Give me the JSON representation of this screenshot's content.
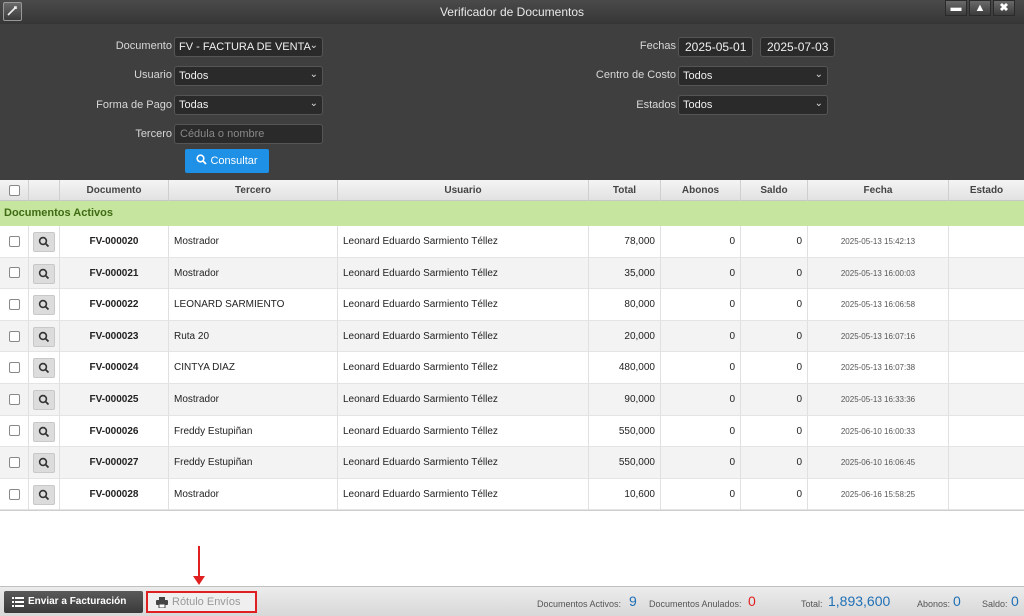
{
  "window": {
    "title": "Verificador de Documentos",
    "buttons": {
      "minimize": "▬",
      "maximize": "▲",
      "close": "✖"
    }
  },
  "filters": {
    "documento_label": "Documento",
    "documento_value": "FV - FACTURA DE VENTA",
    "usuario_label": "Usuario",
    "usuario_value": "Todos",
    "forma_pago_label": "Forma de Pago",
    "forma_pago_value": "Todas",
    "tercero_label": "Tercero",
    "tercero_placeholder": "Cédula o nombre",
    "fechas_label": "Fechas",
    "fecha_desde": "2025-05-01",
    "fecha_hasta": "2025-07-03",
    "centro_costo_label": "Centro de Costo",
    "centro_costo_value": "Todos",
    "estados_label": "Estados",
    "estados_value": "Todos",
    "consultar_label": "Consultar"
  },
  "table": {
    "headers": [
      "Documento",
      "Tercero",
      "Usuario",
      "Total",
      "Abonos",
      "Saldo",
      "Fecha",
      "Estado"
    ],
    "group_label": "Documentos Activos",
    "rows": [
      {
        "documento": "FV-000020",
        "tercero": "Mostrador",
        "usuario": "Leonard Eduardo Sarmiento Téllez",
        "total": "78,000",
        "abonos": "0",
        "saldo": "0",
        "fecha": "2025-05-13 15:42:13"
      },
      {
        "documento": "FV-000021",
        "tercero": "Mostrador",
        "usuario": "Leonard Eduardo Sarmiento Téllez",
        "total": "35,000",
        "abonos": "0",
        "saldo": "0",
        "fecha": "2025-05-13 16:00:03"
      },
      {
        "documento": "FV-000022",
        "tercero": "LEONARD SARMIENTO",
        "usuario": "Leonard Eduardo Sarmiento Téllez",
        "total": "80,000",
        "abonos": "0",
        "saldo": "0",
        "fecha": "2025-05-13 16:06:58"
      },
      {
        "documento": "FV-000023",
        "tercero": "Ruta 20",
        "usuario": "Leonard Eduardo Sarmiento Téllez",
        "total": "20,000",
        "abonos": "0",
        "saldo": "0",
        "fecha": "2025-05-13 16:07:16"
      },
      {
        "documento": "FV-000024",
        "tercero": "CINTYA DIAZ",
        "usuario": "Leonard Eduardo Sarmiento Téllez",
        "total": "480,000",
        "abonos": "0",
        "saldo": "0",
        "fecha": "2025-05-13 16:07:38"
      },
      {
        "documento": "FV-000025",
        "tercero": "Mostrador",
        "usuario": "Leonard Eduardo Sarmiento Téllez",
        "total": "90,000",
        "abonos": "0",
        "saldo": "0",
        "fecha": "2025-05-13 16:33:36"
      },
      {
        "documento": "FV-000026",
        "tercero": "Freddy Estupiñan",
        "usuario": "Leonard Eduardo Sarmiento Téllez",
        "total": "550,000",
        "abonos": "0",
        "saldo": "0",
        "fecha": "2025-06-10 16:00:33"
      },
      {
        "documento": "FV-000027",
        "tercero": "Freddy Estupiñan",
        "usuario": "Leonard Eduardo Sarmiento Téllez",
        "total": "550,000",
        "abonos": "0",
        "saldo": "0",
        "fecha": "2025-06-10 16:06:45"
      },
      {
        "documento": "FV-000028",
        "tercero": "Mostrador",
        "usuario": "Leonard Eduardo Sarmiento Téllez",
        "total": "10,600",
        "abonos": "0",
        "saldo": "0",
        "fecha": "2025-06-16 15:58:25"
      }
    ]
  },
  "footer": {
    "enviar_label": "Enviar a Facturación",
    "rotulo_label": "Rótulo Envíos",
    "activos_label": "Documentos Activos:",
    "activos_value": "9",
    "anulados_label": "Documentos Anulados:",
    "anulados_value": "0",
    "total_label": "Total:",
    "total_value": "1,893,600",
    "abonos_label": "Abonos:",
    "abonos_value": "0",
    "saldo_label": "Saldo:",
    "saldo_value": "0"
  },
  "colors": {
    "accent": "#1e90e6",
    "group_bg": "#c6e59e",
    "highlight": "#e02020"
  },
  "icons": [
    "app-icon",
    "chevron-down-icon",
    "search-icon",
    "magnifier-icon",
    "list-icon",
    "printer-icon",
    "arrow-down-icon"
  ]
}
